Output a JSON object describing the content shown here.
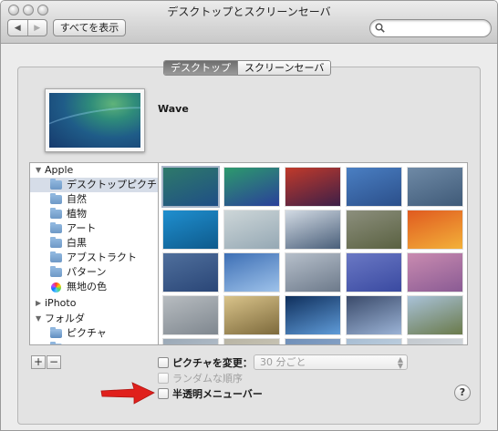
{
  "window": {
    "title": "デスクトップとスクリーンセーバ",
    "nav_back_icon": "chevron-left-icon",
    "nav_forward_icon": "chevron-right-icon",
    "show_all_label": "すべてを表示",
    "search": {
      "value": "",
      "placeholder": ""
    }
  },
  "tabs": [
    {
      "label": "デスクトップ",
      "active": true
    },
    {
      "label": "スクリーンセーバ",
      "active": false
    }
  ],
  "preview": {
    "name": "Wave"
  },
  "source_list": {
    "items": [
      {
        "label": "Apple",
        "kind": "group",
        "expanded": true
      },
      {
        "label": "デスクトップピクチャ",
        "kind": "folder",
        "selected": true
      },
      {
        "label": "自然",
        "kind": "folder"
      },
      {
        "label": "植物",
        "kind": "folder"
      },
      {
        "label": "アート",
        "kind": "folder"
      },
      {
        "label": "白黒",
        "kind": "folder"
      },
      {
        "label": "アブストラクト",
        "kind": "folder"
      },
      {
        "label": "パターン",
        "kind": "folder"
      },
      {
        "label": "無地の色",
        "kind": "color"
      },
      {
        "label": "iPhoto",
        "kind": "group",
        "expanded": false
      },
      {
        "label": "フォルダ",
        "kind": "group",
        "expanded": true
      },
      {
        "label": "ピクチャ",
        "kind": "folder-special"
      },
      {
        "label": "",
        "kind": "folder-special"
      }
    ]
  },
  "thumbnails": [
    {
      "name": "wave-thumbnail",
      "colors": [
        "#2e7a6a",
        "#1f4e86"
      ]
    },
    {
      "name": "abstract-green-thumbnail",
      "colors": [
        "#2d9a6c",
        "#2a3f9a"
      ]
    },
    {
      "name": "red-canyon-thumbnail",
      "colors": [
        "#c13a2a",
        "#3d1f48"
      ]
    },
    {
      "name": "blue-wave-thumbnail",
      "colors": [
        "#4a7fc3",
        "#2b4f8a"
      ]
    },
    {
      "name": "gray-blue-thumbnail",
      "colors": [
        "#6f8aa6",
        "#3f5a78"
      ]
    },
    {
      "name": "blue-water-thumbnail",
      "colors": [
        "#1f8fcf",
        "#0e5a8c"
      ]
    },
    {
      "name": "beach-thumbnail",
      "colors": [
        "#cdd6d8",
        "#95a8b4"
      ]
    },
    {
      "name": "frosted-trees-thumbnail",
      "colors": [
        "#d2dae3",
        "#4a5f7a"
      ]
    },
    {
      "name": "grass-thumbnail",
      "colors": [
        "#8c8f7d",
        "#5a6141"
      ]
    },
    {
      "name": "orange-leaves-thumbnail",
      "colors": [
        "#e05a1f",
        "#f3b13a"
      ]
    },
    {
      "name": "blue-pattern-thumbnail",
      "colors": [
        "#4f6f9c",
        "#2a4677"
      ]
    },
    {
      "name": "blue-streak-thumbnail",
      "colors": [
        "#3d6fb5",
        "#9ec2ea"
      ]
    },
    {
      "name": "silver-thumbnail",
      "colors": [
        "#b6bfca",
        "#6d7a8b"
      ]
    },
    {
      "name": "purple-waves-thumbnail",
      "colors": [
        "#6a78c4",
        "#3a4aa1"
      ]
    },
    {
      "name": "pink-dunes-thumbnail",
      "colors": [
        "#c98bb0",
        "#8a5b94"
      ]
    },
    {
      "name": "misty-lake-thumbnail",
      "colors": [
        "#b7bcc0",
        "#7f878f"
      ]
    },
    {
      "name": "golden-sky-thumbnail",
      "colors": [
        "#d9c38a",
        "#7d6a3c"
      ]
    },
    {
      "name": "earth-thumbnail",
      "colors": [
        "#0f2f5c",
        "#5f9bd8"
      ]
    },
    {
      "name": "space-thumbnail",
      "colors": [
        "#3a4a6a",
        "#9bb3d6"
      ]
    },
    {
      "name": "elephant-thumbnail",
      "colors": [
        "#a9c2d9",
        "#6a7a4a"
      ]
    },
    {
      "name": "partial-thumbnail-1",
      "colors": [
        "#9aa8b6",
        "#c8d1da"
      ]
    },
    {
      "name": "partial-thumbnail-2",
      "colors": [
        "#b8b4a4",
        "#d8d4c4"
      ]
    },
    {
      "name": "partial-thumbnail-3",
      "colors": [
        "#6f8fb8",
        "#9fb6d4"
      ]
    },
    {
      "name": "partial-thumbnail-4",
      "colors": [
        "#a7bdd3",
        "#d4e0ea"
      ]
    },
    {
      "name": "partial-thumbnail-5",
      "colors": [
        "#c3c9cf",
        "#e1e5e8"
      ]
    }
  ],
  "controls": {
    "add_label": "+",
    "remove_label": "−",
    "change_picture_label": "ピクチャを変更：",
    "change_picture_checked": false,
    "interval_value": "30 分ごと",
    "random_order_label": "ランダムな順序",
    "random_order_enabled": false,
    "translucent_menubar_label": "半透明メニューバー",
    "translucent_menubar_checked": false,
    "help_label": "?"
  },
  "annotation": {
    "arrow_color": "#e0201c"
  }
}
